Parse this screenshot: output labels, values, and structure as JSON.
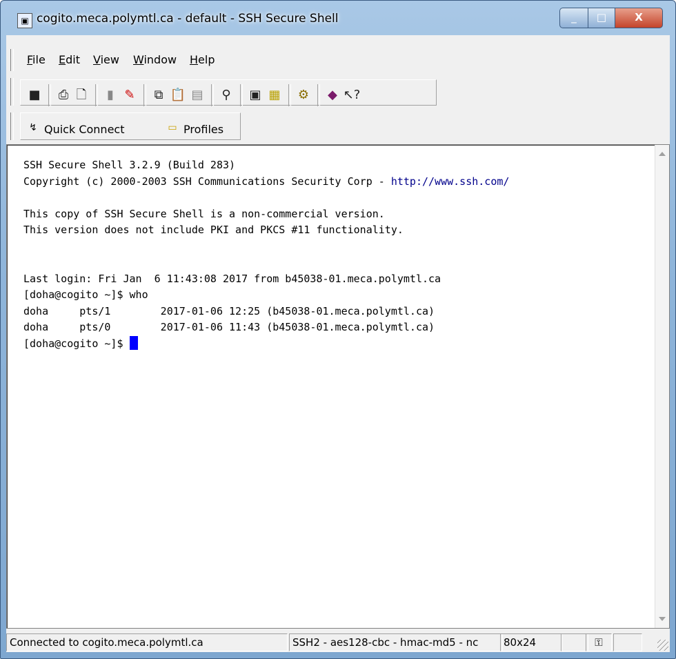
{
  "window": {
    "title": "cogito.meca.polymtl.ca - default - SSH Secure Shell",
    "controls": {
      "minimize": "_",
      "maximize": "□",
      "close": "X"
    }
  },
  "menu": {
    "items": [
      {
        "label": "File",
        "accel": "F",
        "rest": "ile"
      },
      {
        "label": "Edit",
        "accel": "E",
        "rest": "dit"
      },
      {
        "label": "View",
        "accel": "V",
        "rest": "iew"
      },
      {
        "label": "Window",
        "accel": "W",
        "rest": "indow"
      },
      {
        "label": "Help",
        "accel": "H",
        "rest": "elp"
      }
    ]
  },
  "toolbar": {
    "icons": [
      "save-icon",
      "print-icon",
      "print-preview-icon",
      "disconnect-icon",
      "edit-settings-icon",
      "copy-icon",
      "paste-icon",
      "paste-alt-icon",
      "find-icon",
      "new-terminal-icon",
      "new-file-transfer-icon",
      "settings-icon",
      "help-book-icon",
      "context-help-icon"
    ]
  },
  "quickbar": {
    "quick_connect_label": "Quick Connect",
    "profiles_label": "Profiles"
  },
  "terminal": {
    "lines": [
      "SSH Secure Shell 3.2.9 (Build 283)",
      "Copyright (c) 2000-2003 SSH Communications Security Corp - ",
      "",
      "This copy of SSH Secure Shell is a non-commercial version.",
      "This version does not include PKI and PKCS #11 functionality.",
      "",
      "",
      "Last login: Fri Jan  6 11:43:08 2017 from b45038-01.meca.polymtl.ca",
      "[doha@cogito ~]$ who",
      "doha     pts/1        2017-01-06 12:25 (b45038-01.meca.polymtl.ca)",
      "doha     pts/0        2017-01-06 11:43 (b45038-01.meca.polymtl.ca)",
      "[doha@cogito ~]$ "
    ],
    "link": "http://www.ssh.com/",
    "cursor_color": "#0000ff"
  },
  "status": {
    "connection": "Connected to cogito.meca.polymtl.ca",
    "cipher": "SSH2 - aes128-cbc - hmac-md5 - nc",
    "size": "80x24"
  }
}
